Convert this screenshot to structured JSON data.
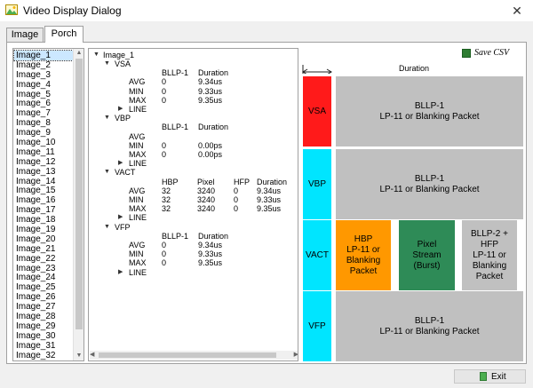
{
  "window": {
    "title": "Video Display Dialog",
    "close_glyph": "✕"
  },
  "tabs": [
    {
      "label": "Image"
    },
    {
      "label": "Porch"
    }
  ],
  "image_list": [
    "Image_1",
    "Image_2",
    "Image_3",
    "Image_4",
    "Image_5",
    "Image_6",
    "Image_7",
    "Image_8",
    "Image_9",
    "Image_10",
    "Image_11",
    "Image_12",
    "Image_13",
    "Image_14",
    "Image_15",
    "Image_16",
    "Image_17",
    "Image_18",
    "Image_19",
    "Image_20",
    "Image_21",
    "Image_22",
    "Image_23",
    "Image_24",
    "Image_25",
    "Image_26",
    "Image_27",
    "Image_28",
    "Image_29",
    "Image_30",
    "Image_31",
    "Image_32"
  ],
  "tree": {
    "root": "Image_1",
    "groups": [
      {
        "name": "VSA",
        "headers": [
          "BLLP-1",
          "Duration"
        ],
        "rows": [
          {
            "label": "AVG",
            "values": [
              "0",
              "9.34us"
            ]
          },
          {
            "label": "MIN",
            "values": [
              "0",
              "9.33us"
            ]
          },
          {
            "label": "MAX",
            "values": [
              "0",
              "9.35us"
            ]
          }
        ],
        "sub": "LINE"
      },
      {
        "name": "VBP",
        "headers": [
          "BLLP-1",
          "Duration"
        ],
        "rows": [
          {
            "label": "AVG",
            "values": [
              "",
              ""
            ]
          },
          {
            "label": "MIN",
            "values": [
              "0",
              "0.00ps"
            ]
          },
          {
            "label": "MAX",
            "values": [
              "0",
              "0.00ps"
            ]
          }
        ],
        "sub": "LINE"
      },
      {
        "name": "VACT",
        "headers": [
          "HBP",
          "Pixel",
          "HFP",
          "Duration"
        ],
        "rows": [
          {
            "label": "AVG",
            "values": [
              "32",
              "3240",
              "0",
              "9.34us"
            ]
          },
          {
            "label": "MIN",
            "values": [
              "32",
              "3240",
              "0",
              "9.33us"
            ]
          },
          {
            "label": "MAX",
            "values": [
              "32",
              "3240",
              "0",
              "9.35us"
            ]
          }
        ],
        "sub": "LINE"
      },
      {
        "name": "VFP",
        "headers": [
          "BLLP-1",
          "Duration"
        ],
        "rows": [
          {
            "label": "AVG",
            "values": [
              "0",
              "9.34us"
            ]
          },
          {
            "label": "MIN",
            "values": [
              "0",
              "9.33us"
            ]
          },
          {
            "label": "MAX",
            "values": [
              "0",
              "9.35us"
            ]
          }
        ],
        "sub": "LINE"
      }
    ]
  },
  "diagram": {
    "save_csv": "Save CSV",
    "duration_label": "Duration",
    "rows": [
      {
        "label": "VSA",
        "color": "#ff1a1a",
        "box": [
          "BLLP-1",
          "LP-11 or Blanking Packet"
        ]
      },
      {
        "label": "VBP",
        "color": "#00e5ff",
        "box": [
          "BLLP-1",
          "LP-11 or Blanking Packet"
        ]
      },
      {
        "label": "VACT",
        "color": "#00e5ff",
        "boxes": [
          {
            "lines": [
              "HBP",
              "LP-11 or",
              "Blanking",
              "Packet"
            ],
            "color": "#ff9800"
          },
          {
            "lines": [
              "Pixel",
              "Stream (Burst)"
            ],
            "color": "#2e8b57"
          },
          {
            "lines": [
              "BLLP-2 + HFP",
              "LP-11 or",
              "Blanking",
              "Packet"
            ],
            "color": "#c0c0c0"
          }
        ]
      },
      {
        "label": "VFP",
        "color": "#00e5ff",
        "box": [
          "BLLP-1",
          "LP-11 or Blanking Packet"
        ]
      }
    ]
  },
  "footer": {
    "exit_label": "Exit"
  },
  "icons": {
    "app": "picture-icon",
    "save": "save-csv-icon",
    "exit": "exit-door-icon"
  }
}
